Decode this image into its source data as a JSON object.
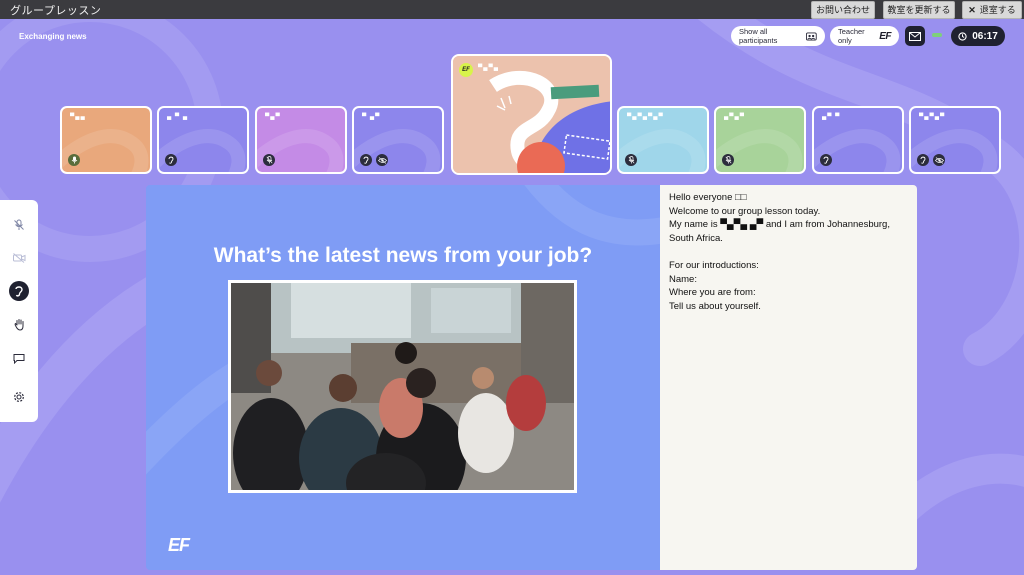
{
  "window": {
    "title": "グループレッスン",
    "buttons": {
      "contact": "お問い合わせ",
      "refresh": "教室を更新する",
      "exit": "退室する"
    }
  },
  "lesson": {
    "title": "Exchanging news"
  },
  "header": {
    "show_all": "Show all participants",
    "teacher_only": "Teacher only",
    "ef_mark": "EF",
    "timer": "06:17"
  },
  "teacher": {
    "badge": "EF",
    "name": "▀▄▀▄"
  },
  "participants": [
    {
      "name": "▀▄▄",
      "color": "#e9a87c",
      "icons": [
        "mic-icon"
      ]
    },
    {
      "name": "▄ ▀ ▄",
      "color": "#8d86ec",
      "icons": [
        "ear-icon"
      ]
    },
    {
      "name": "▀▄▀",
      "color": "#c48be6",
      "icons": [
        "mic-off-icon"
      ]
    },
    {
      "name": "▀ ▄▀",
      "color": "#8d86ec",
      "icons": [
        "ear-icon",
        "eye-off-icon"
      ]
    },
    {
      "name": "▀▄▀▄▀▄▀",
      "color": "#9fd6ea",
      "icons": [
        "mic-off-icon"
      ]
    },
    {
      "name": "▄▀▄▀",
      "color": "#a8d39a",
      "icons": [
        "mic-off-icon"
      ]
    },
    {
      "name": "▄▀ ▀",
      "color": "#8d86ec",
      "icons": [
        "ear-icon"
      ]
    },
    {
      "name": "▀▄▀▄▀",
      "color": "#8d86ec",
      "icons": [
        "ear-icon",
        "eye-off-icon"
      ]
    }
  ],
  "slide": {
    "heading": "What’s the latest news from your job?",
    "logo": "EF"
  },
  "chat": {
    "lines": [
      "Hello everyone □□",
      "Welcome to our group lesson today.",
      "My name is ▀▄▀▄ ▄▀ and I am from Johannesburg,",
      "South Africa.",
      "",
      "For our introductions:",
      "Name:",
      "Where you are from:",
      "Tell us about yourself."
    ]
  },
  "toolbar": {
    "items": [
      "mic-off-icon",
      "camera-off-icon",
      "ear-icon",
      "raise-hand-icon",
      "chat-icon",
      "settings-icon"
    ],
    "active": "ear-icon"
  }
}
